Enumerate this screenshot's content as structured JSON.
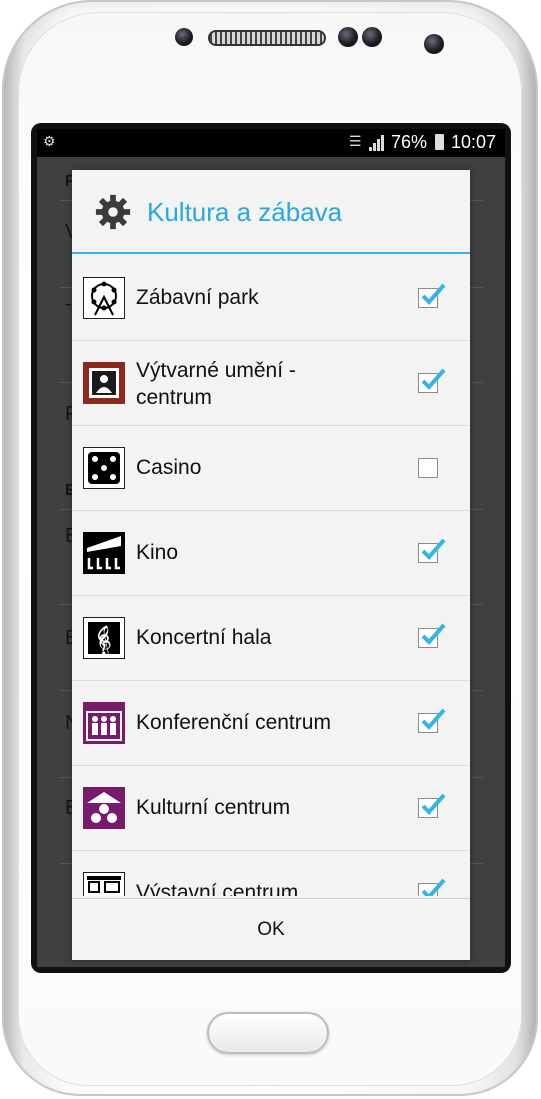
{
  "status_bar": {
    "battery": "76%",
    "time": "10:07"
  },
  "background": {
    "letters": [
      "F",
      "V",
      "-",
      "F",
      "E",
      "E",
      "E",
      "N",
      "E"
    ]
  },
  "dialog": {
    "title": "Kultura a zábava",
    "ok_label": "OK",
    "accent_color": "#33b5e5",
    "items": [
      {
        "label": "Zábavní park",
        "icon": "amusement-park-icon",
        "checked": true
      },
      {
        "label": "Výtvarné umění - centrum",
        "icon": "art-gallery-icon",
        "checked": true
      },
      {
        "label": "Casino",
        "icon": "dice-icon",
        "checked": false
      },
      {
        "label": "Kino",
        "icon": "cinema-icon",
        "checked": true
      },
      {
        "label": "Koncertní hala",
        "icon": "treble-clef-icon",
        "checked": true
      },
      {
        "label": "Konferenční centrum",
        "icon": "conference-icon",
        "checked": true
      },
      {
        "label": "Kulturní centrum",
        "icon": "culture-center-icon",
        "checked": true
      },
      {
        "label": "Výstavní centrum",
        "icon": "exhibition-icon",
        "checked": true
      }
    ]
  }
}
